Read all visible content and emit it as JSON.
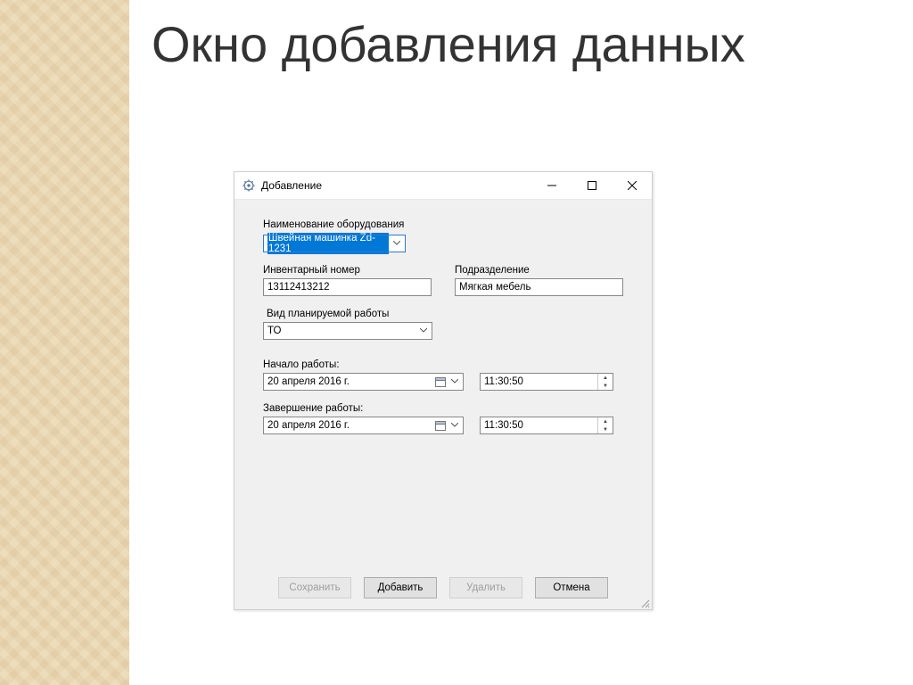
{
  "slide": {
    "title": "Окно добавления данных"
  },
  "window": {
    "title": "Добавление",
    "labels": {
      "equipment": "Наименование оборудования",
      "inventory": "Инвентарный номер",
      "department": "Подразделение",
      "work_type": "Вид планируемой работы",
      "start": "Начало работы:",
      "end": "Завершение работы:"
    },
    "values": {
      "equipment": "Швейная машинка Zd-1231",
      "inventory": "13112413212",
      "department": "Мягкая мебель",
      "work_type": "ТО",
      "start_date": "20  апреля   2016 г.",
      "start_time": "11:30:50",
      "end_date": "20  апреля   2016 г.",
      "end_time": "11:30:50"
    },
    "buttons": {
      "save": "Сохранить",
      "add": "Добавить",
      "delete": "Удалить",
      "cancel": "Отмена"
    }
  }
}
